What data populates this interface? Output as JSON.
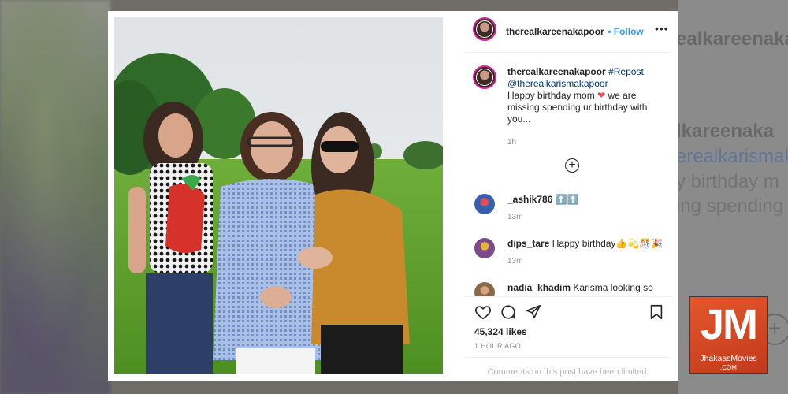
{
  "background": {
    "username_echo": "ealkareenakapoor",
    "caption_echo": [
      "lkareenaka",
      "erealkarismak",
      "y birthday m",
      "ing spending"
    ]
  },
  "post": {
    "username": "therealkareenakapoor",
    "follow_label": "Follow",
    "more_label": "•••",
    "caption": {
      "username": "therealkareenakapoor",
      "hashtag": "#Repost",
      "mention": "@therealkarismakapoor",
      "text_before_heart": "Happy birthday mom",
      "heart": "❤",
      "text_after_heart": " we are missing spending ur birthday with you...",
      "time": "1h"
    },
    "load_more_label": "+",
    "comments": [
      {
        "username": "_ashik786",
        "text": "⬆️⬆️",
        "time": "13m",
        "avatar_color": "#3a5fb0"
      },
      {
        "username": "dips_tare",
        "text": "Happy birthday👍💫🎊🎉",
        "time": "13m",
        "avatar_color": "#7a4a8a"
      },
      {
        "username": "nadia_khadim",
        "text": "Karisma looking so",
        "time": "",
        "avatar_color": "#8a6a4a"
      }
    ],
    "likes": "45,324 likes",
    "posted_ago": "1 HOUR AGO",
    "comments_limited": "Comments on this post have been limited."
  },
  "watermark": {
    "main": "JM",
    "name": "JhakaasMovies",
    "domain": ".COM"
  },
  "colors": {
    "follow": "#3897f0",
    "heart": "#ed4956",
    "logo": "#e4572e"
  }
}
